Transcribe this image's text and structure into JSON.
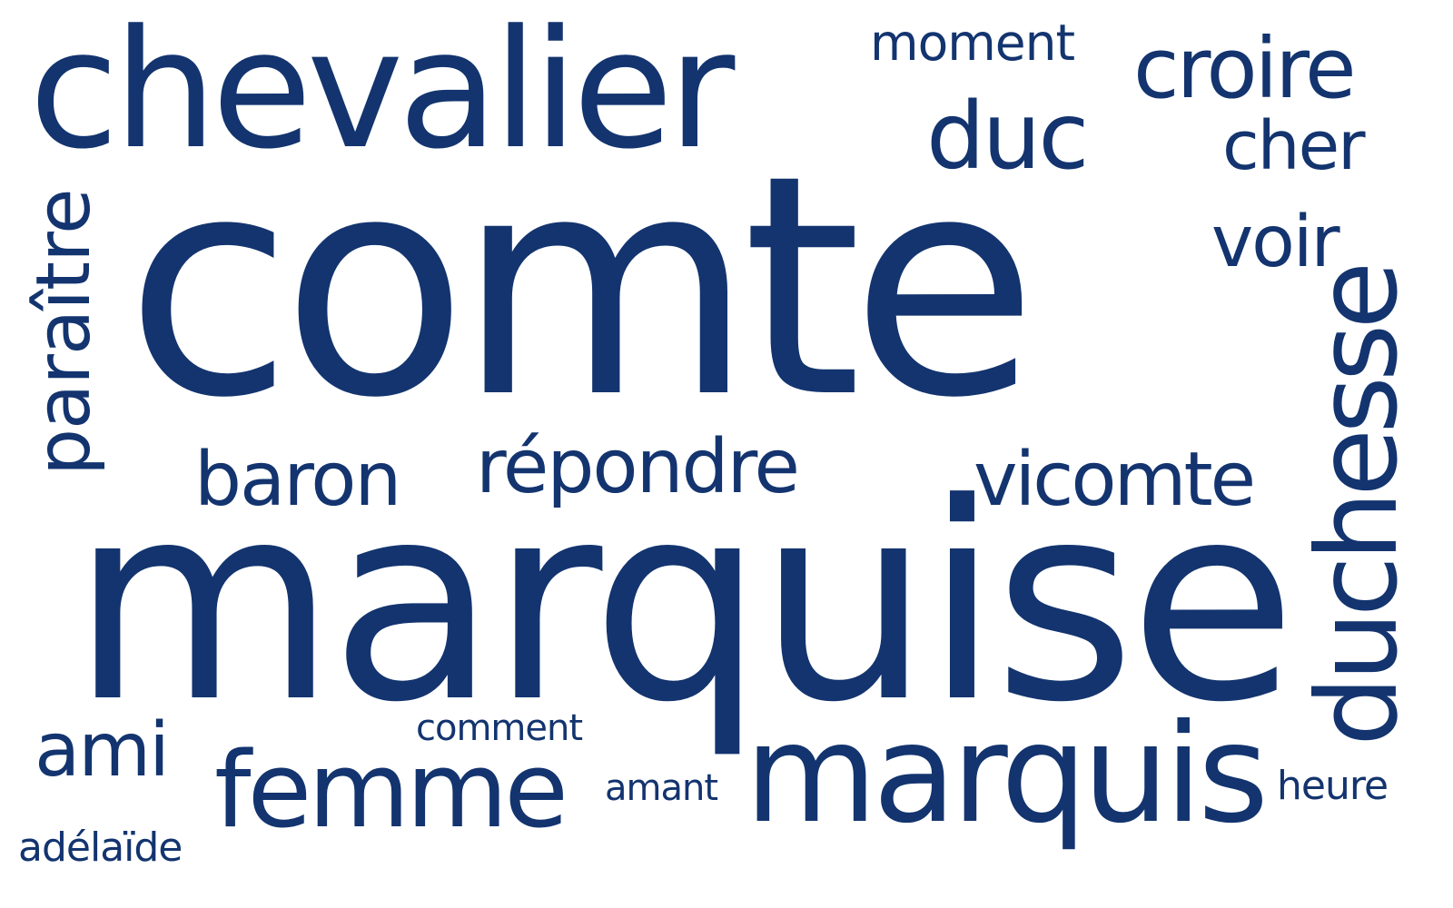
{
  "color": "#13346f",
  "words": [
    {
      "text": "comte"
    },
    {
      "text": "marquise"
    },
    {
      "text": "chevalier"
    },
    {
      "text": "marquis"
    },
    {
      "text": "duchesse"
    },
    {
      "text": "femme"
    },
    {
      "text": "paraître"
    },
    {
      "text": "croire"
    },
    {
      "text": "répondre"
    },
    {
      "text": "vicomte"
    },
    {
      "text": "duc"
    },
    {
      "text": "baron"
    },
    {
      "text": "voir"
    },
    {
      "text": "cher"
    },
    {
      "text": "ami"
    },
    {
      "text": "moment"
    },
    {
      "text": "comment"
    },
    {
      "text": "heure"
    },
    {
      "text": "amant"
    },
    {
      "text": "adélaïde"
    }
  ]
}
